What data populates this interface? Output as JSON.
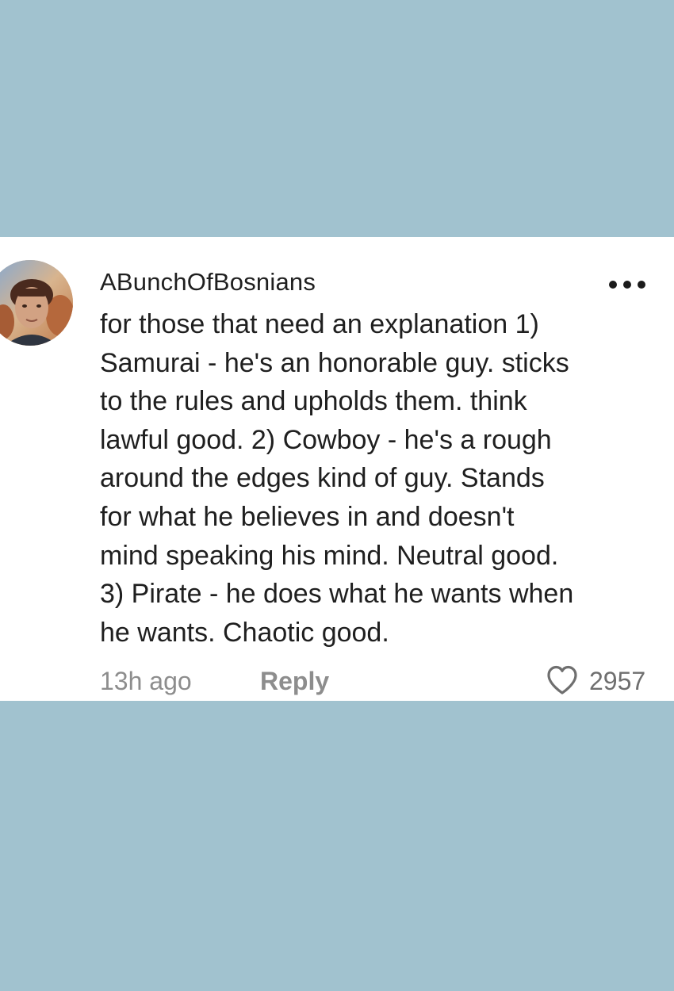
{
  "colors": {
    "page_background": "#a1c2cf",
    "card_background": "#ffffff",
    "primary_text": "#1f1f1f",
    "secondary_text": "#8d8d8d"
  },
  "comment": {
    "username": "ABunchOfBosnians",
    "avatar_icon": "profile-avatar",
    "more_icon": "ellipsis-horizontal-icon",
    "text_lines": [
      "for those that need an explanation 1)",
      "Samurai - he's an honorable guy. sticks",
      "to the rules and upholds them. think",
      "lawful good. 2) Cowboy - he's a rough",
      "around the edges kind of guy. Stands",
      "for what he believes in and doesn't",
      "mind speaking his mind. Neutral good.",
      "3) Pirate - he does what he wants when",
      "he wants. Chaotic good."
    ],
    "timestamp": "13h ago",
    "reply_label": "Reply",
    "like_icon": "heart-outline-icon",
    "like_count": "2957"
  }
}
